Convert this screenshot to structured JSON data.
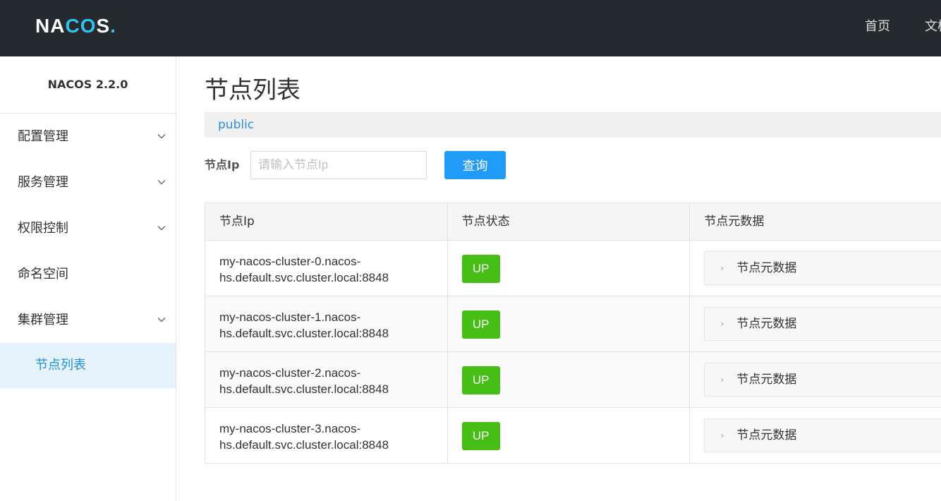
{
  "header": {
    "logo": {
      "n": "NA",
      "c": "C",
      "o": "O",
      "s": "S",
      "dot": "."
    },
    "nav": [
      "首页",
      "文档"
    ]
  },
  "sidebar": {
    "title": "NACOS 2.2.0",
    "items": [
      {
        "label": "配置管理",
        "expandable": true
      },
      {
        "label": "服务管理",
        "expandable": true
      },
      {
        "label": "权限控制",
        "expandable": true
      },
      {
        "label": "命名空间",
        "expandable": false
      },
      {
        "label": "集群管理",
        "expandable": true
      }
    ],
    "active_sub": "节点列表"
  },
  "main": {
    "title": "节点列表",
    "namespace": "public",
    "search": {
      "label": "节点Ip",
      "placeholder": "请输入节点Ip",
      "button": "查询"
    },
    "table": {
      "headers": [
        "节点Ip",
        "节点状态",
        "节点元数据"
      ],
      "rows": [
        {
          "ip_line1": "my-nacos-cluster-0.nacos-",
          "ip_line2": "hs.default.svc.cluster.local:8848",
          "status": "UP",
          "meta": "节点元数据"
        },
        {
          "ip_line1": "my-nacos-cluster-1.nacos-",
          "ip_line2": "hs.default.svc.cluster.local:8848",
          "status": "UP",
          "meta": "节点元数据"
        },
        {
          "ip_line1": "my-nacos-cluster-2.nacos-",
          "ip_line2": "hs.default.svc.cluster.local:8848",
          "status": "UP",
          "meta": "节点元数据"
        },
        {
          "ip_line1": "my-nacos-cluster-3.nacos-",
          "ip_line2": "hs.default.svc.cluster.local:8848",
          "status": "UP",
          "meta": "节点元数据"
        }
      ]
    }
  },
  "colors": {
    "header_bg": "#252a2f",
    "accent": "#209bfa",
    "status_up": "#46be16",
    "logo_accent": "#2fc1f0"
  }
}
